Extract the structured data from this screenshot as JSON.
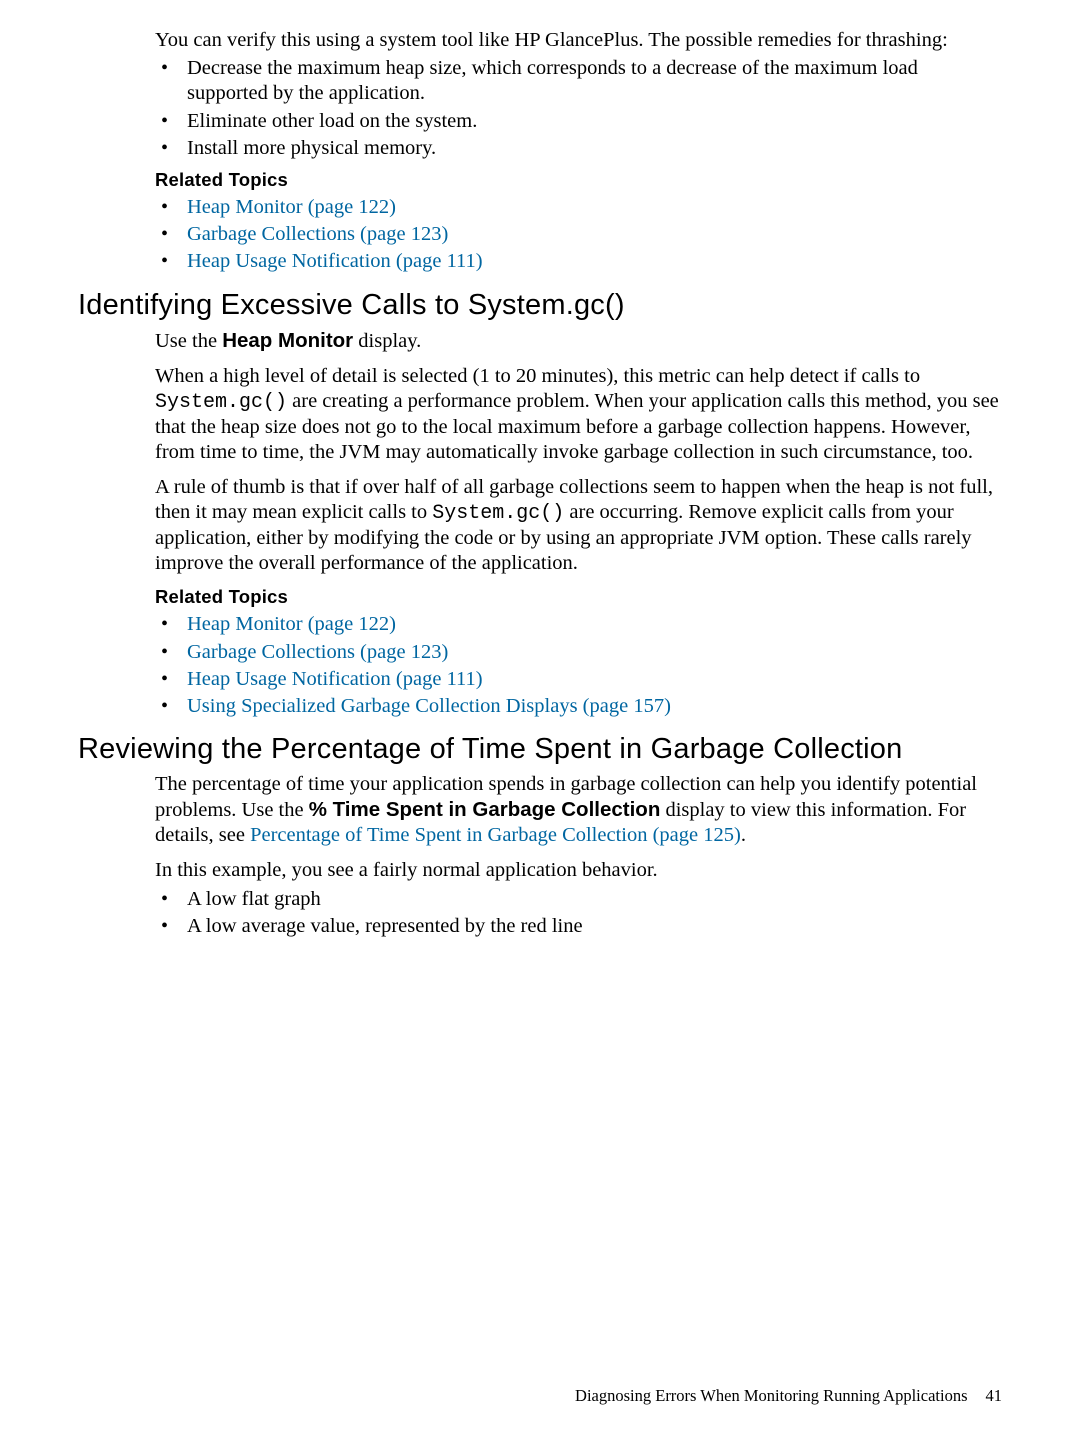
{
  "intro_line": "You can verify this using a system tool like HP GlancePlus. The possible remedies for thrashing:",
  "remedies": [
    "Decrease the maximum heap size, which corresponds to a decrease of the maximum load supported by the application.",
    "Eliminate other load on the system.",
    "Install more physical memory."
  ],
  "related_topics_label": "Related Topics",
  "rt1": [
    "Heap Monitor (page 122)",
    "Garbage Collections (page 123)",
    "Heap Usage Notification (page 111)"
  ],
  "section1_heading": "Identifying Excessive Calls to System.gc()",
  "use_heap_prefix": "Use the ",
  "heap_monitor_bold": "Heap Monitor",
  "use_heap_suffix": " display.",
  "para1_a": "When a high level of detail is selected (1 to 20 minutes), this metric can help detect if calls to ",
  "para1_code": "System.gc()",
  "para1_b": " are creating a performance problem. When your application calls this method, you see that the heap size does not go to the local maximum before a garbage collection happens. However, from time to time, the JVM may automatically invoke garbage collection in such circumstance, too.",
  "para2_a": "A rule of thumb is that if over half of all garbage collections seem to happen when the heap is not full, then it may mean explicit calls to ",
  "para2_code": "System.gc()",
  "para2_b": " are occurring. Remove explicit calls from your application, either by modifying the code or by using an appropriate JVM option. These calls rarely improve the overall performance of the application.",
  "rt2": [
    "Heap Monitor (page 122)",
    "Garbage Collections (page 123)",
    "Heap Usage Notification (page 111)",
    " Using Specialized Garbage Collection Displays (page 157)"
  ],
  "section2_heading": "Reviewing the Percentage of Time Spent in Garbage Collection",
  "para3_a": "The percentage of time your application spends in garbage collection can help you identify potential problems. Use the ",
  "pct_bold": "% Time Spent in Garbage Collection",
  "para3_b": " display to view this information. For details, see ",
  "para3_link": "Percentage of Time Spent in Garbage Collection (page 125)",
  "para3_c": ".",
  "para4": "In this example, you see a fairly normal application behavior.",
  "example_bullets": [
    "A low flat graph",
    "A low average value, represented by the red line"
  ],
  "footer_text": "Diagnosing Errors When Monitoring Running Applications",
  "page_number": "41"
}
